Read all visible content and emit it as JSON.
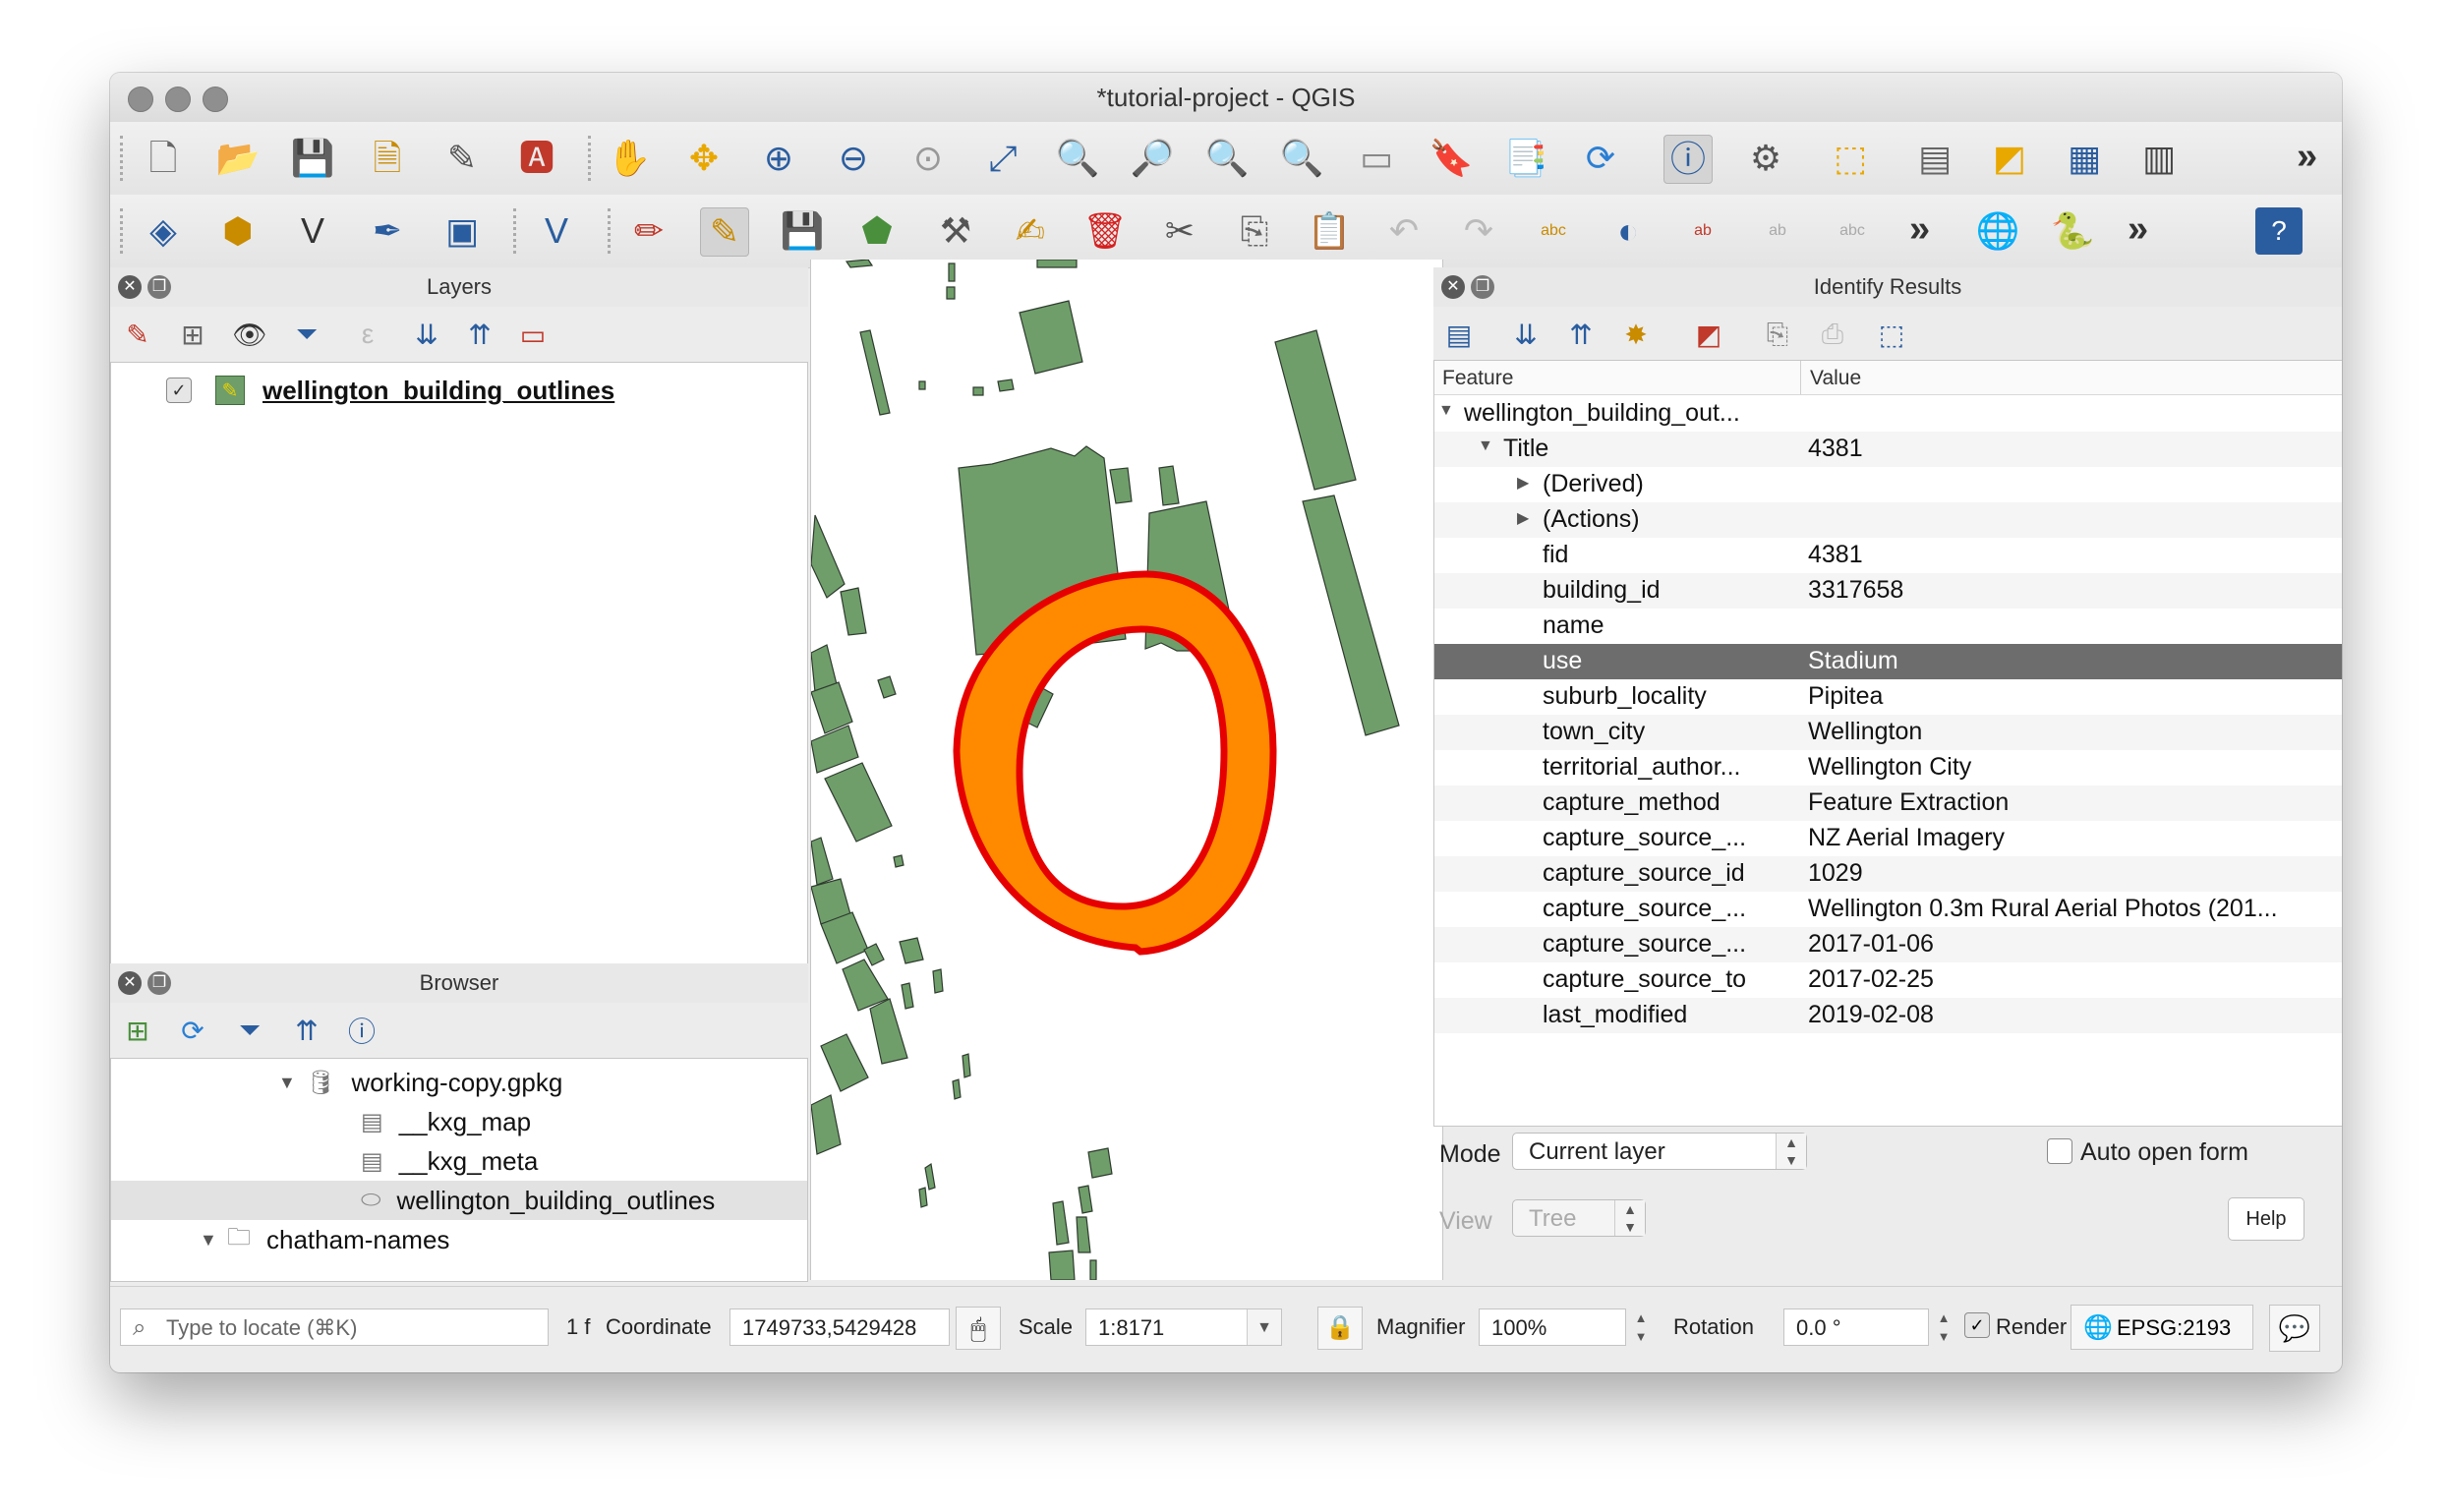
{
  "window": {
    "title": "*tutorial-project - QGIS"
  },
  "panels": {
    "layers": {
      "title": "Layers",
      "layer_name": "wellington_building_outlines"
    },
    "browser": {
      "title": "Browser",
      "items": [
        "working-copy.gpkg",
        "__kxg_map",
        "__kxg_meta",
        "wellington_building_outlines",
        "chatham-names"
      ]
    },
    "identify": {
      "title": "Identify Results",
      "header_feature": "Feature",
      "header_value": "Value",
      "rows": [
        {
          "feature": "wellington_building_out...",
          "value": ""
        },
        {
          "feature": "Title",
          "value": "4381"
        },
        {
          "feature": "(Derived)",
          "value": ""
        },
        {
          "feature": "(Actions)",
          "value": ""
        },
        {
          "feature": "fid",
          "value": "4381"
        },
        {
          "feature": "building_id",
          "value": "3317658"
        },
        {
          "feature": "name",
          "value": ""
        },
        {
          "feature": "use",
          "value": "Stadium"
        },
        {
          "feature": "suburb_locality",
          "value": "Pipitea"
        },
        {
          "feature": "town_city",
          "value": "Wellington"
        },
        {
          "feature": "territorial_author...",
          "value": "Wellington City"
        },
        {
          "feature": "capture_method",
          "value": "Feature Extraction"
        },
        {
          "feature": "capture_source_...",
          "value": "NZ Aerial Imagery"
        },
        {
          "feature": "capture_source_id",
          "value": "1029"
        },
        {
          "feature": "capture_source_...",
          "value": "Wellington 0.3m Rural Aerial Photos (201..."
        },
        {
          "feature": "capture_source_...",
          "value": "2017-01-06"
        },
        {
          "feature": "capture_source_to",
          "value": "2017-02-25"
        },
        {
          "feature": "last_modified",
          "value": "2019-02-08"
        }
      ],
      "mode_label": "Mode",
      "mode_value": "Current layer",
      "auto_open_label": "Auto open form",
      "view_label": "View",
      "view_value": "Tree",
      "help_label": "Help"
    }
  },
  "statusbar": {
    "locate_placeholder": "Type to locate (⌘K)",
    "feature_count": "1 f",
    "coordinate_label": "Coordinate",
    "coordinate_value": "1749733,5429428",
    "scale_label": "Scale",
    "scale_value": "1:8171",
    "magnifier_label": "Magnifier",
    "magnifier_value": "100%",
    "rotation_label": "Rotation",
    "rotation_value": "0.0 °",
    "render_label": "Render",
    "crs_value": "EPSG:2193"
  },
  "colors": {
    "building_fill": "#6f9e6a",
    "selected_fill": "#ff8a00",
    "selected_outline": "#e60000",
    "selected_row": "#6d6d6d"
  }
}
